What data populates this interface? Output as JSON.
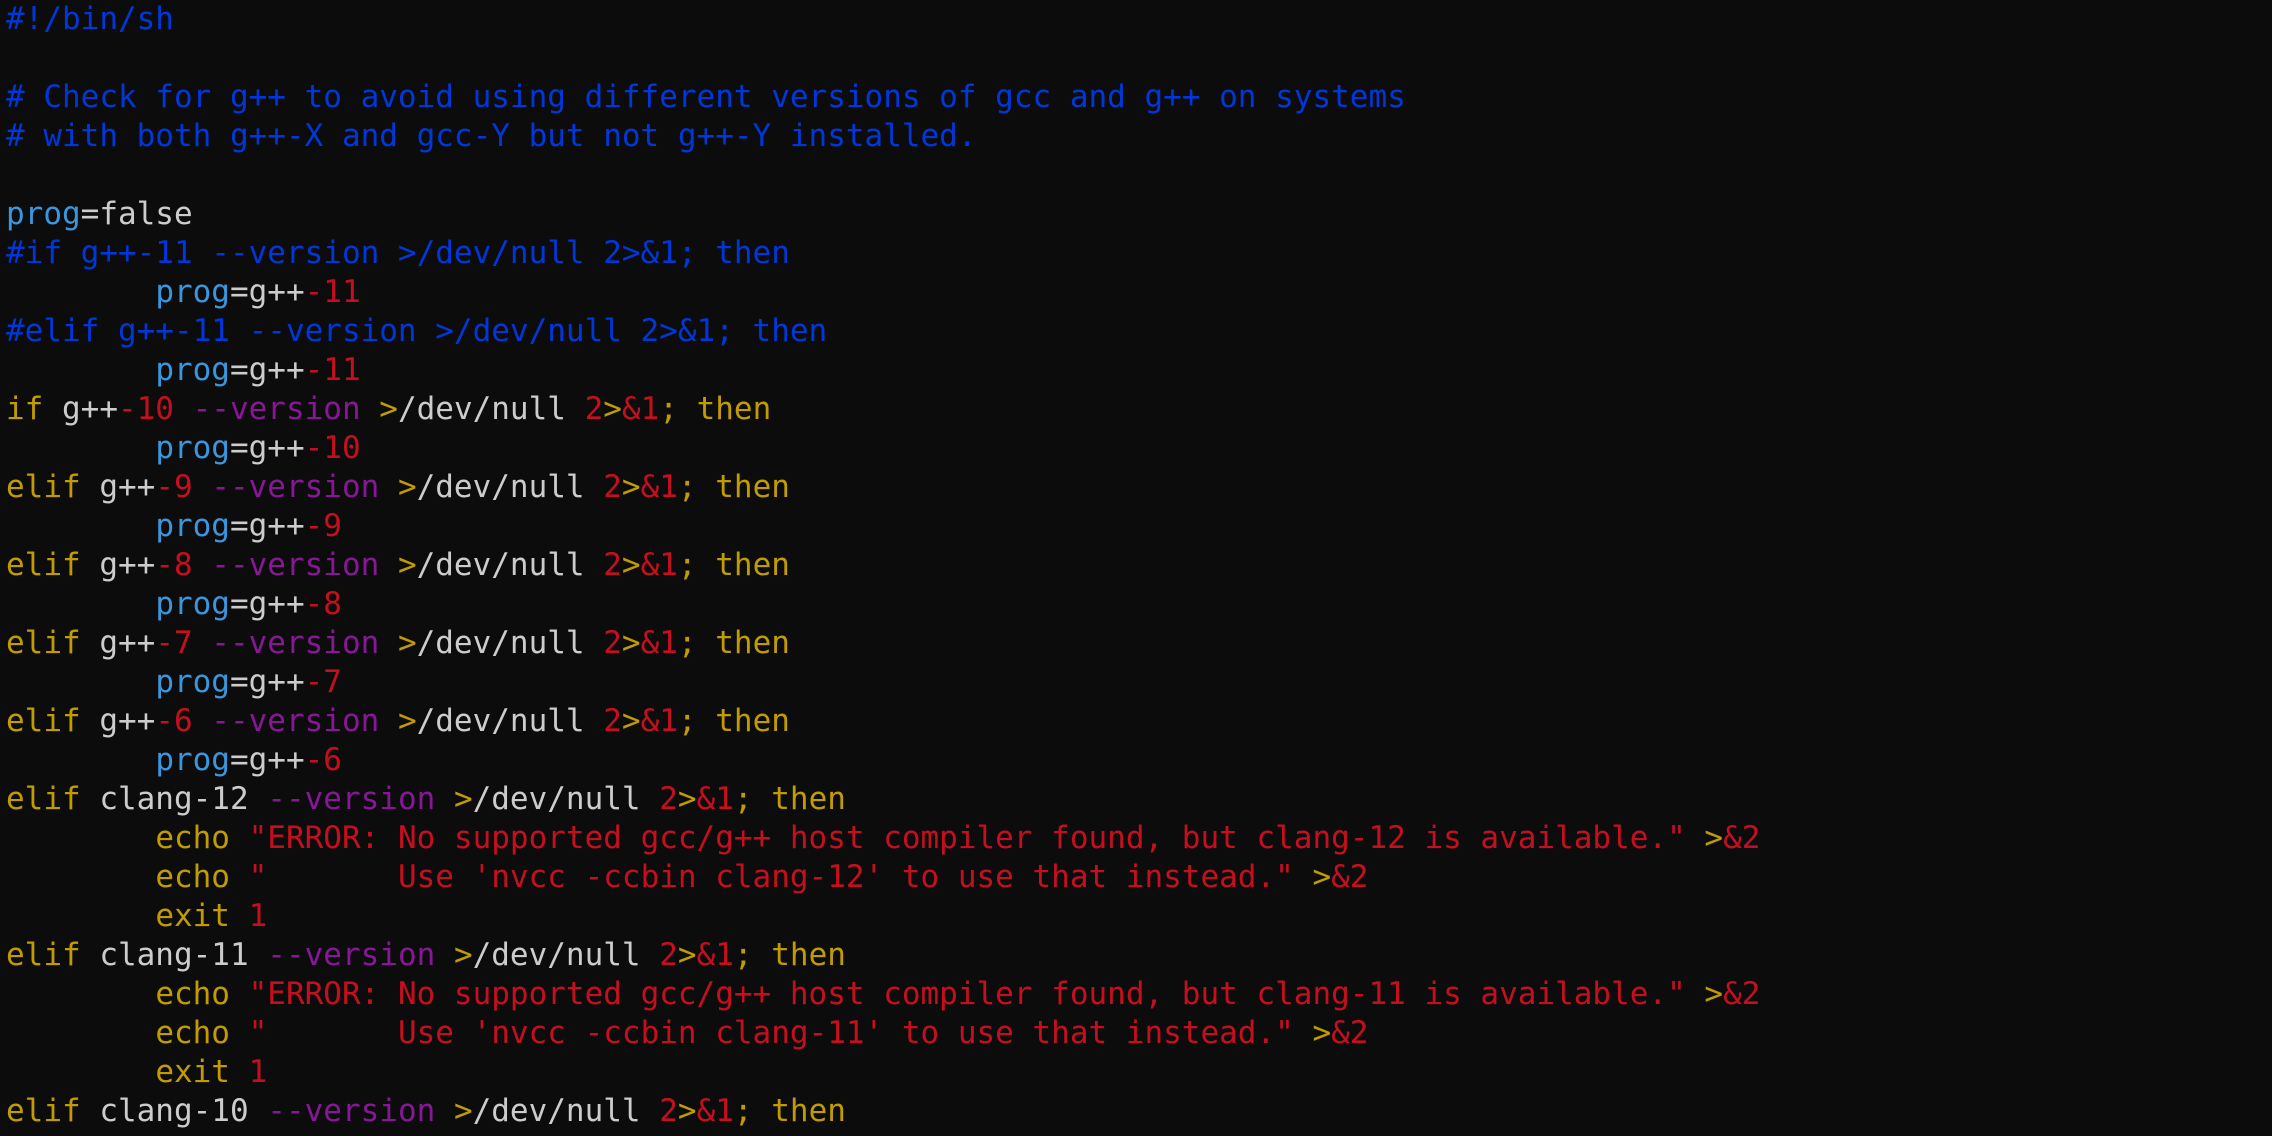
{
  "editor": {
    "colors": {
      "background": "#0c0c0c",
      "comment": "#0037da",
      "keyword": "#c19c00",
      "var": "#3a96dd",
      "default": "#cccccc",
      "number": "#c50f1f",
      "option": "#881798",
      "op": "#c19c00",
      "string": "#c50f1f"
    },
    "lines": [
      [
        {
          "t": "#!/bin/sh",
          "c": "comment"
        }
      ],
      [],
      [
        {
          "t": "# Check for g++ to avoid using different versions of gcc and g++ on systems",
          "c": "comment"
        }
      ],
      [
        {
          "t": "# with both g++-X and gcc-Y but not g++-Y installed.",
          "c": "comment"
        }
      ],
      [],
      [
        {
          "t": "prog",
          "c": "var"
        },
        {
          "t": "=false",
          "c": "default"
        }
      ],
      [
        {
          "t": "#if g++-11 --version >/dev/null 2>&1; then",
          "c": "comment"
        }
      ],
      [
        {
          "t": "        ",
          "c": "default"
        },
        {
          "t": "prog",
          "c": "var"
        },
        {
          "t": "=g++",
          "c": "default"
        },
        {
          "t": "-11",
          "c": "number"
        }
      ],
      [
        {
          "t": "#elif g++-11 --version >/dev/null 2>&1; then",
          "c": "comment"
        }
      ],
      [
        {
          "t": "        ",
          "c": "default"
        },
        {
          "t": "prog",
          "c": "var"
        },
        {
          "t": "=g++",
          "c": "default"
        },
        {
          "t": "-11",
          "c": "number"
        }
      ],
      [
        {
          "t": "if",
          "c": "keyword"
        },
        {
          "t": " g++",
          "c": "default"
        },
        {
          "t": "-10",
          "c": "number"
        },
        {
          "t": " --version",
          "c": "option"
        },
        {
          "t": " >",
          "c": "op"
        },
        {
          "t": "/dev/null ",
          "c": "default"
        },
        {
          "t": "2",
          "c": "number"
        },
        {
          "t": ">",
          "c": "op"
        },
        {
          "t": "&1",
          "c": "number"
        },
        {
          "t": "; then",
          "c": "keyword"
        }
      ],
      [
        {
          "t": "        ",
          "c": "default"
        },
        {
          "t": "prog",
          "c": "var"
        },
        {
          "t": "=g++",
          "c": "default"
        },
        {
          "t": "-10",
          "c": "number"
        }
      ],
      [
        {
          "t": "elif",
          "c": "keyword"
        },
        {
          "t": " g++",
          "c": "default"
        },
        {
          "t": "-9",
          "c": "number"
        },
        {
          "t": " --version",
          "c": "option"
        },
        {
          "t": " >",
          "c": "op"
        },
        {
          "t": "/dev/null ",
          "c": "default"
        },
        {
          "t": "2",
          "c": "number"
        },
        {
          "t": ">",
          "c": "op"
        },
        {
          "t": "&1",
          "c": "number"
        },
        {
          "t": "; then",
          "c": "keyword"
        }
      ],
      [
        {
          "t": "        ",
          "c": "default"
        },
        {
          "t": "prog",
          "c": "var"
        },
        {
          "t": "=g++",
          "c": "default"
        },
        {
          "t": "-9",
          "c": "number"
        }
      ],
      [
        {
          "t": "elif",
          "c": "keyword"
        },
        {
          "t": " g++",
          "c": "default"
        },
        {
          "t": "-8",
          "c": "number"
        },
        {
          "t": " --version",
          "c": "option"
        },
        {
          "t": " >",
          "c": "op"
        },
        {
          "t": "/dev/null ",
          "c": "default"
        },
        {
          "t": "2",
          "c": "number"
        },
        {
          "t": ">",
          "c": "op"
        },
        {
          "t": "&1",
          "c": "number"
        },
        {
          "t": "; then",
          "c": "keyword"
        }
      ],
      [
        {
          "t": "        ",
          "c": "default"
        },
        {
          "t": "prog",
          "c": "var"
        },
        {
          "t": "=g++",
          "c": "default"
        },
        {
          "t": "-8",
          "c": "number"
        }
      ],
      [
        {
          "t": "elif",
          "c": "keyword"
        },
        {
          "t": " g++",
          "c": "default"
        },
        {
          "t": "-7",
          "c": "number"
        },
        {
          "t": " --version",
          "c": "option"
        },
        {
          "t": " >",
          "c": "op"
        },
        {
          "t": "/dev/null ",
          "c": "default"
        },
        {
          "t": "2",
          "c": "number"
        },
        {
          "t": ">",
          "c": "op"
        },
        {
          "t": "&1",
          "c": "number"
        },
        {
          "t": "; then",
          "c": "keyword"
        }
      ],
      [
        {
          "t": "        ",
          "c": "default"
        },
        {
          "t": "prog",
          "c": "var"
        },
        {
          "t": "=g++",
          "c": "default"
        },
        {
          "t": "-7",
          "c": "number"
        }
      ],
      [
        {
          "t": "elif",
          "c": "keyword"
        },
        {
          "t": " g++",
          "c": "default"
        },
        {
          "t": "-6",
          "c": "number"
        },
        {
          "t": " --version",
          "c": "option"
        },
        {
          "t": " >",
          "c": "op"
        },
        {
          "t": "/dev/null ",
          "c": "default"
        },
        {
          "t": "2",
          "c": "number"
        },
        {
          "t": ">",
          "c": "op"
        },
        {
          "t": "&1",
          "c": "number"
        },
        {
          "t": "; then",
          "c": "keyword"
        }
      ],
      [
        {
          "t": "        ",
          "c": "default"
        },
        {
          "t": "prog",
          "c": "var"
        },
        {
          "t": "=g++",
          "c": "default"
        },
        {
          "t": "-6",
          "c": "number"
        }
      ],
      [
        {
          "t": "elif",
          "c": "keyword"
        },
        {
          "t": " clang-12",
          "c": "default"
        },
        {
          "t": " --version",
          "c": "option"
        },
        {
          "t": " >",
          "c": "op"
        },
        {
          "t": "/dev/null ",
          "c": "default"
        },
        {
          "t": "2",
          "c": "number"
        },
        {
          "t": ">",
          "c": "op"
        },
        {
          "t": "&1",
          "c": "number"
        },
        {
          "t": "; then",
          "c": "keyword"
        }
      ],
      [
        {
          "t": "        ",
          "c": "default"
        },
        {
          "t": "echo",
          "c": "keyword"
        },
        {
          "t": " \"ERROR: No supported gcc/g++ host compiler found, but clang-12 is available.\"",
          "c": "string"
        },
        {
          "t": " >",
          "c": "op"
        },
        {
          "t": "&2",
          "c": "number"
        }
      ],
      [
        {
          "t": "        ",
          "c": "default"
        },
        {
          "t": "echo",
          "c": "keyword"
        },
        {
          "t": " \"       Use 'nvcc -ccbin clang-12' to use that instead.\"",
          "c": "string"
        },
        {
          "t": " >",
          "c": "op"
        },
        {
          "t": "&2",
          "c": "number"
        }
      ],
      [
        {
          "t": "        ",
          "c": "default"
        },
        {
          "t": "exit",
          "c": "keyword"
        },
        {
          "t": " 1",
          "c": "number"
        }
      ],
      [
        {
          "t": "elif",
          "c": "keyword"
        },
        {
          "t": " clang-11",
          "c": "default"
        },
        {
          "t": " --version",
          "c": "option"
        },
        {
          "t": " >",
          "c": "op"
        },
        {
          "t": "/dev/null ",
          "c": "default"
        },
        {
          "t": "2",
          "c": "number"
        },
        {
          "t": ">",
          "c": "op"
        },
        {
          "t": "&1",
          "c": "number"
        },
        {
          "t": "; then",
          "c": "keyword"
        }
      ],
      [
        {
          "t": "        ",
          "c": "default"
        },
        {
          "t": "echo",
          "c": "keyword"
        },
        {
          "t": " \"ERROR: No supported gcc/g++ host compiler found, but clang-11 is available.\"",
          "c": "string"
        },
        {
          "t": " >",
          "c": "op"
        },
        {
          "t": "&2",
          "c": "number"
        }
      ],
      [
        {
          "t": "        ",
          "c": "default"
        },
        {
          "t": "echo",
          "c": "keyword"
        },
        {
          "t": " \"       Use 'nvcc -ccbin clang-11' to use that instead.\"",
          "c": "string"
        },
        {
          "t": " >",
          "c": "op"
        },
        {
          "t": "&2",
          "c": "number"
        }
      ],
      [
        {
          "t": "        ",
          "c": "default"
        },
        {
          "t": "exit",
          "c": "keyword"
        },
        {
          "t": " 1",
          "c": "number"
        }
      ],
      [
        {
          "t": "elif",
          "c": "keyword"
        },
        {
          "t": " clang-10",
          "c": "default"
        },
        {
          "t": " --version",
          "c": "option"
        },
        {
          "t": " >",
          "c": "op"
        },
        {
          "t": "/dev/null ",
          "c": "default"
        },
        {
          "t": "2",
          "c": "number"
        },
        {
          "t": ">",
          "c": "op"
        },
        {
          "t": "&1",
          "c": "number"
        },
        {
          "t": "; then",
          "c": "keyword"
        }
      ]
    ]
  }
}
